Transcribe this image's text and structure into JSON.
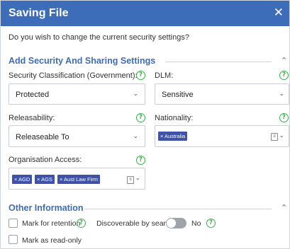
{
  "dialog": {
    "title": "Saving File",
    "close_glyph": "✕"
  },
  "question": "Do you wish to change the current security settings?",
  "security_section": {
    "title": "Add Security And Sharing Settings",
    "security_classification": {
      "label": "Security Classification (Government):",
      "value": "Protected"
    },
    "dlm": {
      "label": "DLM:",
      "value": "Sensitive"
    },
    "releasability": {
      "label": "Releasability:",
      "value": "Releaseable To"
    },
    "nationality": {
      "label": "Nationality:",
      "chips": [
        "× Australia"
      ]
    },
    "organisation_access": {
      "label": "Organisation Access:",
      "chips": [
        "× AGD",
        "× AGS",
        "× Aust Law Firm"
      ]
    }
  },
  "other_section": {
    "title": "Other Information",
    "mark_for_retention": "Mark for retention",
    "discoverable": {
      "label": "Discoverable by search",
      "state": "No"
    },
    "mark_read_only": "Mark as read-only"
  },
  "colors": {
    "titlebar": "#3d6cb9",
    "accent": "#3d6cb9",
    "chip": "#3d52a8",
    "help": "#3aaf4c"
  }
}
